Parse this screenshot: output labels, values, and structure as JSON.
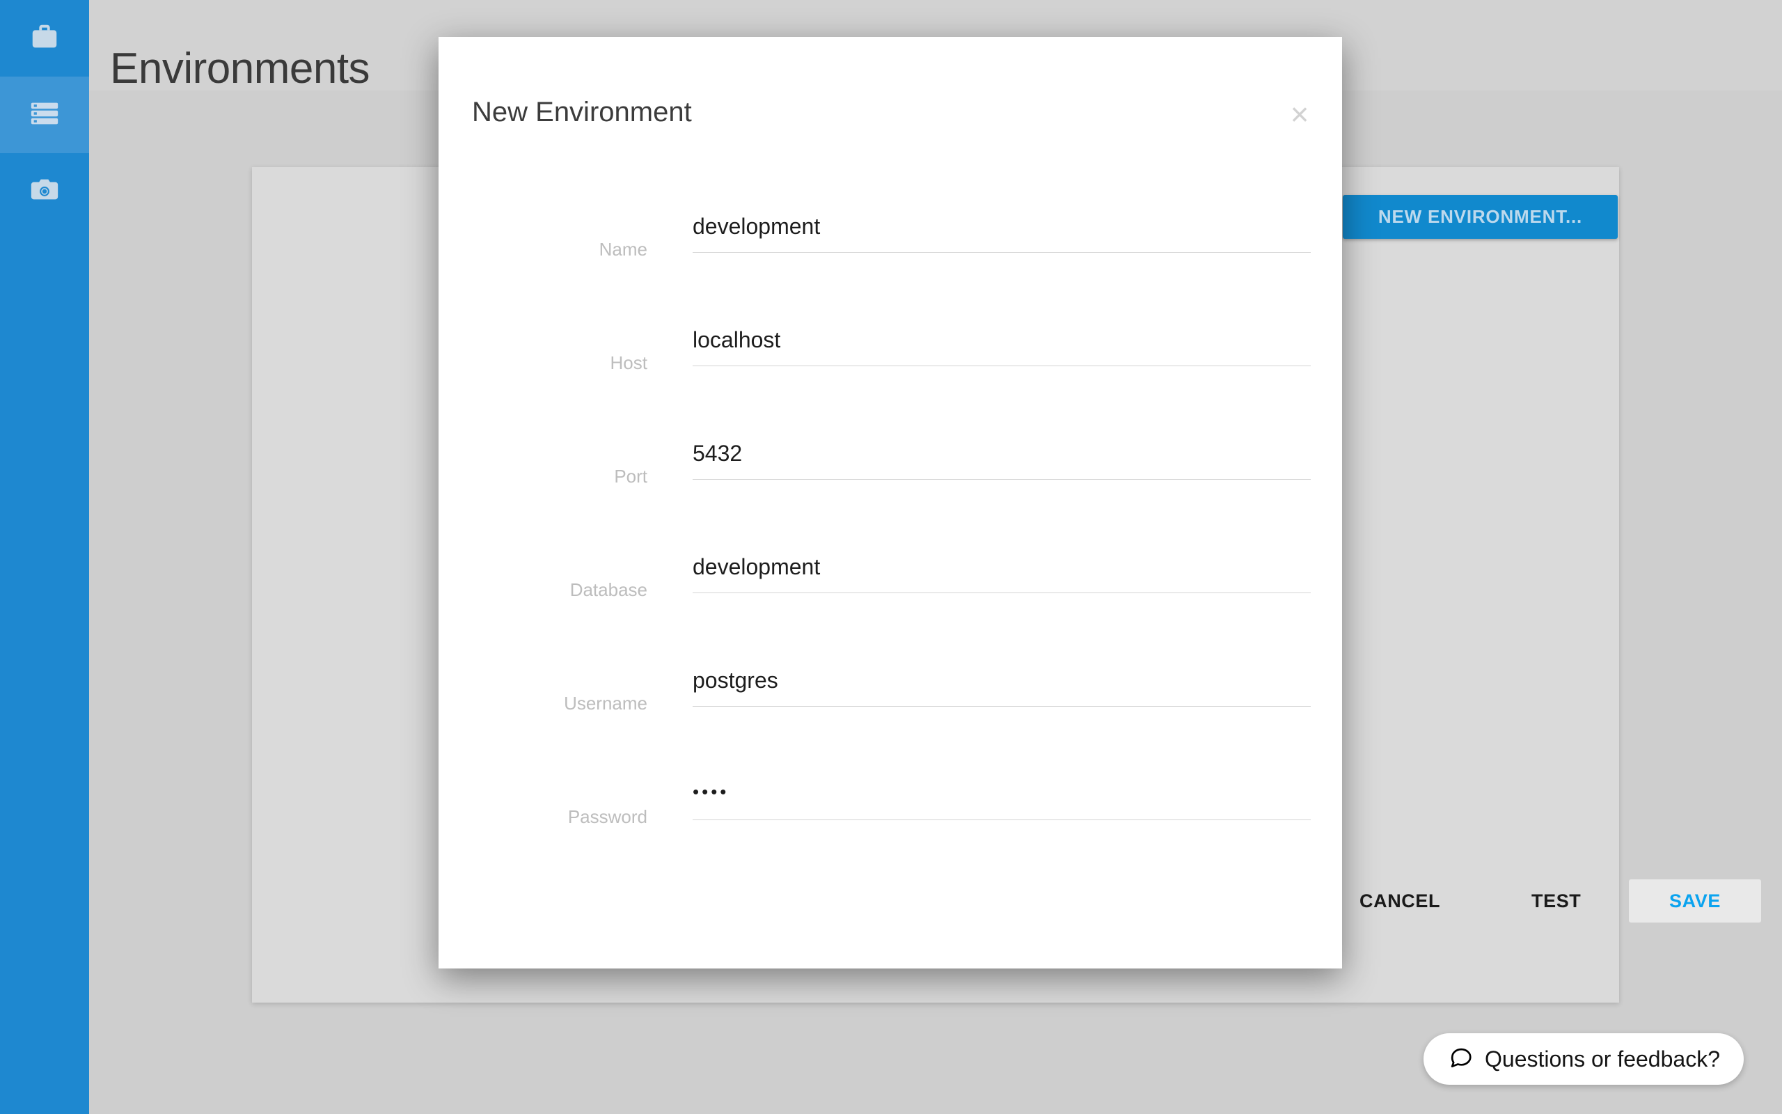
{
  "app": {
    "accent_blue": "#1e88d0",
    "sidebar_active_blue": "#3d96d6",
    "save_blue": "#0aa3ef",
    "body_gray": "#cecece",
    "card_gray": "#dadada",
    "header_gray": "#d2d2d2"
  },
  "sidebar": {
    "items": [
      {
        "name": "briefcase-icon",
        "label": "Projects",
        "active": false
      },
      {
        "name": "server-icon",
        "label": "Environments",
        "active": true
      },
      {
        "name": "camera-icon",
        "label": "Snapshots",
        "active": false
      }
    ]
  },
  "header": {
    "title": "Environments"
  },
  "main": {
    "new_environment_button": "NEW ENVIRONMENT..."
  },
  "feedback": {
    "label": "Questions or feedback?",
    "icon": "chat-bubble-icon"
  },
  "modal": {
    "title": "New Environment",
    "close_glyph": "×",
    "fields": [
      {
        "label": "Name",
        "value": "development",
        "placeholder": "",
        "type": "text"
      },
      {
        "label": "Host",
        "value": "localhost",
        "placeholder": "",
        "type": "text"
      },
      {
        "label": "Port",
        "value": "5432",
        "placeholder": "",
        "type": "text"
      },
      {
        "label": "Database",
        "value": "development",
        "placeholder": "",
        "type": "text"
      },
      {
        "label": "Username",
        "value": "postgres",
        "placeholder": "",
        "type": "text"
      },
      {
        "label": "Password",
        "value": "••••",
        "placeholder": "",
        "type": "password"
      }
    ],
    "actions": {
      "cancel": "CANCEL",
      "test": "TEST",
      "save": "SAVE"
    }
  }
}
